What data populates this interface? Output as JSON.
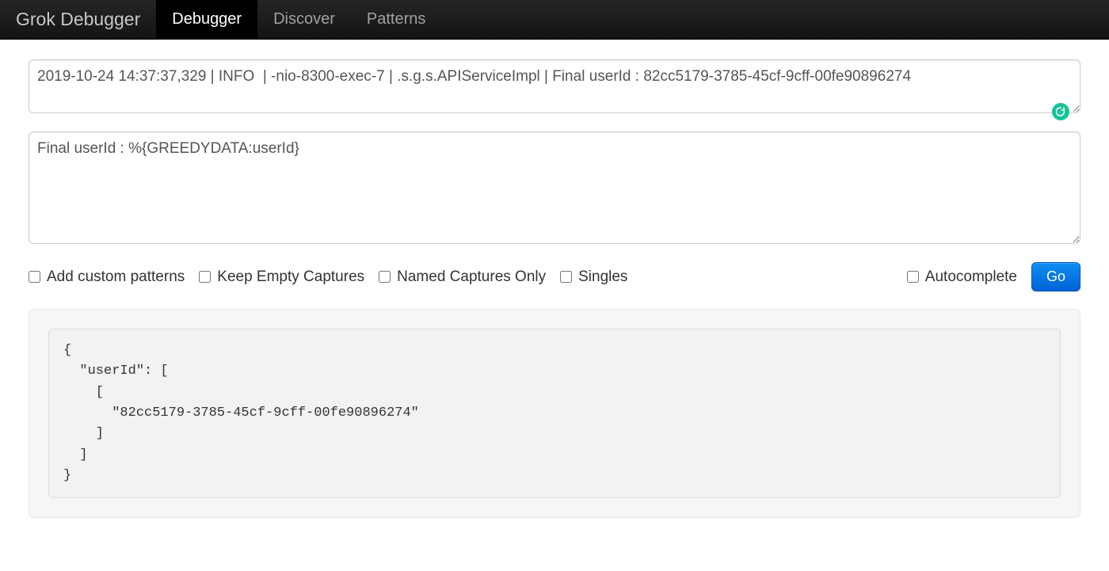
{
  "navbar": {
    "brand": "Grok Debugger",
    "items": [
      {
        "label": "Debugger",
        "active": true
      },
      {
        "label": "Discover",
        "active": false
      },
      {
        "label": "Patterns",
        "active": false
      }
    ]
  },
  "inputs": {
    "log_line": "2019-10-24 14:37:37,329 | INFO  | -nio-8300-exec-7 | .s.g.s.APIServiceImpl | Final userId : 82cc5179-3785-45cf-9cff-00fe90896274",
    "pattern": "Final userId : %{GREEDYDATA:userId}"
  },
  "options": {
    "custom_patterns": "Add custom patterns",
    "keep_empty": "Keep Empty Captures",
    "named_only": "Named Captures Only",
    "singles": "Singles",
    "autocomplete": "Autocomplete",
    "go": "Go"
  },
  "result": "{\n  \"userId\": [\n    [\n      \"82cc5179-3785-45cf-9cff-00fe90896274\"\n    ]\n  ]\n}"
}
